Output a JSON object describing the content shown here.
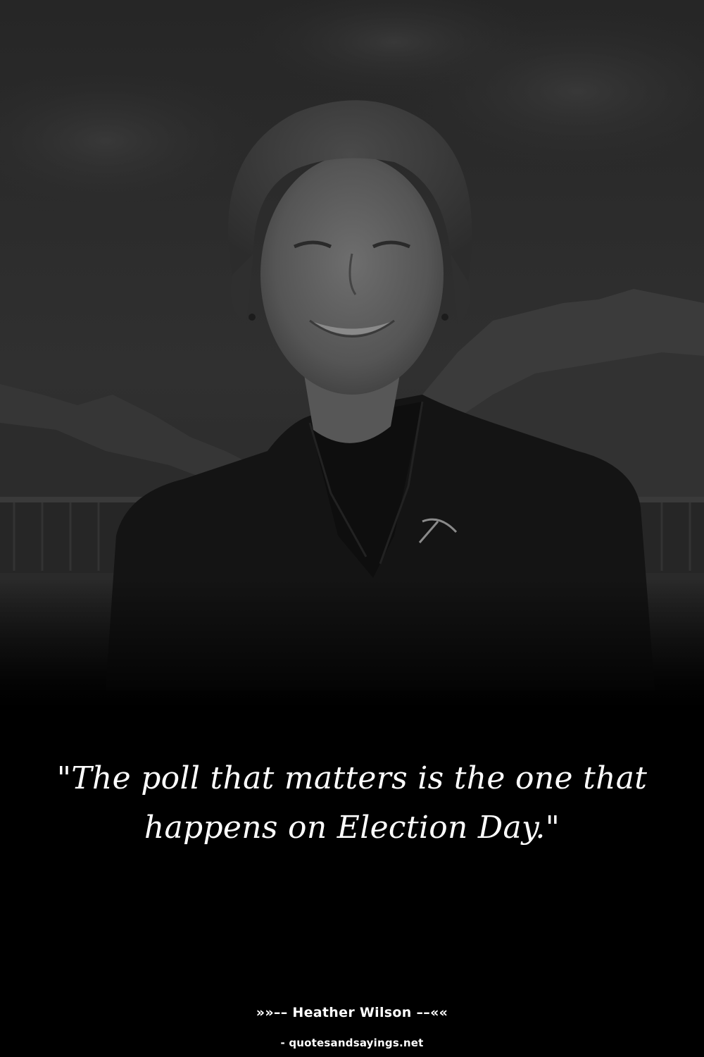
{
  "quote": {
    "text": "\"The poll that matters is the one that happens on Election Day.\""
  },
  "attribution": {
    "author_line": "»»–– Heather Wilson ––««",
    "source_line": "- quotesandsayings.net"
  },
  "background": {
    "subject": "portrait photo of a smiling woman in a dark blazer with a mountain backdrop",
    "tone": "dark grayscale"
  },
  "colors": {
    "text": "#ffffff",
    "background": "#000000"
  }
}
